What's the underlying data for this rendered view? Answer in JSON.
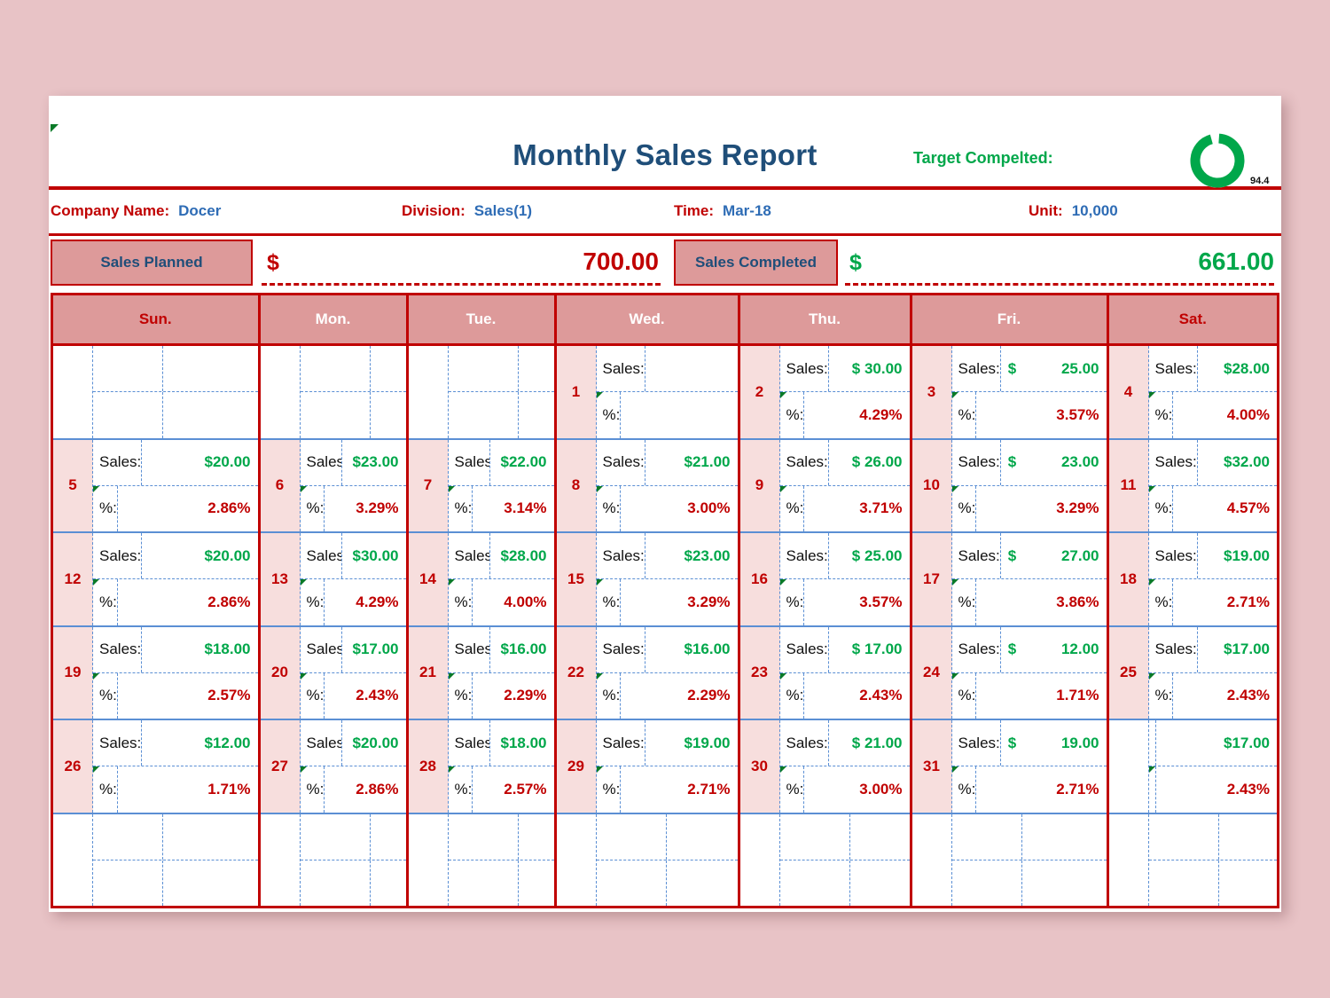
{
  "header": {
    "title": "Monthly Sales Report",
    "target_label": "Target Compelted:",
    "target_percent": "94.4",
    "gauge_value": 94.4,
    "gauge_color": "#00a74a"
  },
  "info": {
    "company_key": "Company Name:",
    "company_value": "Docer",
    "division_key": "Division:",
    "division_value": "Sales(1)",
    "time_key": "Time:",
    "time_value": "Mar-18",
    "unit_key": "Unit:",
    "unit_value": "10,000"
  },
  "totals": {
    "planned_label": "Sales Planned",
    "planned_currency": "$",
    "planned_value": "700.00",
    "completed_label": "Sales Completed",
    "completed_currency": "$",
    "completed_value": "661.00",
    "planned_color": "#c00000",
    "completed_color": "#00a74a"
  },
  "calendar": {
    "day_headers": [
      "Sun.",
      "Mon.",
      "Tue.",
      "Wed.",
      "Thu.",
      "Fri.",
      "Sat."
    ],
    "sales_label": "Sales:",
    "pct_label": "%:",
    "weeks": [
      [
        {
          "day": "",
          "sales": "",
          "pct": "",
          "empty": true
        },
        {
          "day": "",
          "sales": "",
          "pct": "",
          "empty": true
        },
        {
          "day": "",
          "sales": "",
          "pct": "",
          "empty": true
        },
        {
          "day": "1",
          "sales": "",
          "pct": ""
        },
        {
          "day": "2",
          "sales": "$ 30.00",
          "pct": "4.29%"
        },
        {
          "day": "3",
          "currency": "$",
          "sales": "25.00",
          "pct": "3.57%"
        },
        {
          "day": "4",
          "sales": "$28.00",
          "pct": "4.00%"
        }
      ],
      [
        {
          "day": "5",
          "sales": "$20.00",
          "pct": "2.86%"
        },
        {
          "day": "6",
          "sales": "$23.00",
          "pct": "3.29%"
        },
        {
          "day": "7",
          "sales": "$22.00",
          "pct": "3.14%"
        },
        {
          "day": "8",
          "sales": "$21.00",
          "pct": "3.00%"
        },
        {
          "day": "9",
          "sales": "$ 26.00",
          "pct": "3.71%"
        },
        {
          "day": "10",
          "currency": "$",
          "sales": "23.00",
          "pct": "3.29%"
        },
        {
          "day": "11",
          "sales": "$32.00",
          "pct": "4.57%"
        }
      ],
      [
        {
          "day": "12",
          "sales": "$20.00",
          "pct": "2.86%"
        },
        {
          "day": "13",
          "sales": "$30.00",
          "pct": "4.29%"
        },
        {
          "day": "14",
          "sales": "$28.00",
          "pct": "4.00%"
        },
        {
          "day": "15",
          "sales": "$23.00",
          "pct": "3.29%"
        },
        {
          "day": "16",
          "sales": "$ 25.00",
          "pct": "3.57%"
        },
        {
          "day": "17",
          "currency": "$",
          "sales": "27.00",
          "pct": "3.86%"
        },
        {
          "day": "18",
          "sales": "$19.00",
          "pct": "2.71%"
        }
      ],
      [
        {
          "day": "19",
          "sales": "$18.00",
          "pct": "2.57%"
        },
        {
          "day": "20",
          "sales": "$17.00",
          "pct": "2.43%"
        },
        {
          "day": "21",
          "sales": "$16.00",
          "pct": "2.29%"
        },
        {
          "day": "22",
          "sales": "$16.00",
          "pct": "2.29%"
        },
        {
          "day": "23",
          "sales": "$ 17.00",
          "pct": "2.43%"
        },
        {
          "day": "24",
          "currency": "$",
          "sales": "12.00",
          "pct": "1.71%"
        },
        {
          "day": "25",
          "sales": "$17.00",
          "pct": "2.43%"
        }
      ],
      [
        {
          "day": "26",
          "sales": "$12.00",
          "pct": "1.71%"
        },
        {
          "day": "27",
          "sales": "$20.00",
          "pct": "2.86%"
        },
        {
          "day": "28",
          "sales": "$18.00",
          "pct": "2.57%"
        },
        {
          "day": "29",
          "sales": "$19.00",
          "pct": "2.71%"
        },
        {
          "day": "30",
          "sales": "$ 21.00",
          "pct": "3.00%"
        },
        {
          "day": "31",
          "currency": "$",
          "sales": "19.00",
          "pct": "2.71%"
        },
        {
          "day": "",
          "sales": "$17.00",
          "pct": "2.43%",
          "nolabels": true
        }
      ],
      [
        {
          "day": "",
          "sales": "",
          "pct": "",
          "empty": true
        },
        {
          "day": "",
          "sales": "",
          "pct": "",
          "empty": true
        },
        {
          "day": "",
          "sales": "",
          "pct": "",
          "empty": true
        },
        {
          "day": "",
          "sales": "",
          "pct": "",
          "empty": true
        },
        {
          "day": "",
          "sales": "",
          "pct": "",
          "empty": true
        },
        {
          "day": "",
          "sales": "",
          "pct": "",
          "empty": true
        },
        {
          "day": "",
          "sales": "",
          "pct": "",
          "empty": true
        }
      ]
    ]
  }
}
